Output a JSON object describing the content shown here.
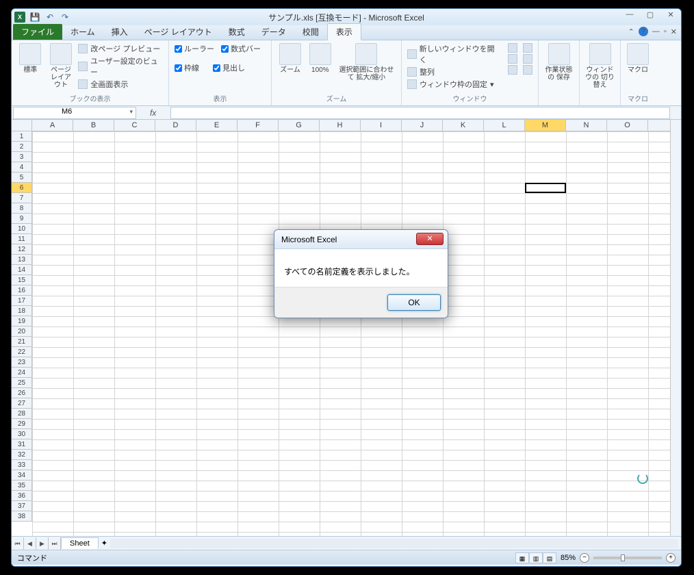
{
  "titlebar": {
    "title": "サンプル.xls [互換モード] - Microsoft Excel",
    "excel_letter": "X"
  },
  "tabs": {
    "file": "ファイル",
    "items": [
      "ホーム",
      "挿入",
      "ページ レイアウト",
      "数式",
      "データ",
      "校閲",
      "表示"
    ],
    "active_index": 6
  },
  "ribbon": {
    "groups": {
      "workbook_views": {
        "label": "ブックの表示",
        "btn_normal": "標準",
        "btn_page_layout": "ページ\nレイアウト",
        "opt_page_break": "改ページ プレビュー",
        "opt_custom_views": "ユーザー設定のビュー",
        "opt_full_screen": "全画面表示"
      },
      "show": {
        "label": "表示",
        "chk_ruler": "ルーラー",
        "chk_formula_bar": "数式バー",
        "chk_gridlines": "枠線",
        "chk_headings": "見出し"
      },
      "zoom": {
        "label": "ズーム",
        "btn_zoom": "ズーム",
        "btn_100": "100%",
        "btn_selection": "選択範囲に合わせて\n拡大/縮小"
      },
      "window": {
        "label": "ウィンドウ",
        "opt_new_window": "新しいウィンドウを開く",
        "opt_arrange": "整列",
        "opt_freeze": "ウィンドウ枠の固定"
      },
      "save_workspace": {
        "btn": "作業状態の\n保存"
      },
      "switch_windows": {
        "btn": "ウィンドウの\n切り替え"
      },
      "macros": {
        "label": "マクロ",
        "btn": "マクロ"
      }
    }
  },
  "namebox": {
    "value": "M6",
    "fx": "fx"
  },
  "columns": [
    "A",
    "B",
    "C",
    "D",
    "E",
    "F",
    "G",
    "H",
    "I",
    "J",
    "K",
    "L",
    "M",
    "N",
    "O"
  ],
  "selected_col_index": 12,
  "rows": [
    1,
    2,
    3,
    4,
    5,
    6,
    7,
    8,
    9,
    10,
    11,
    12,
    13,
    14,
    15,
    16,
    17,
    18,
    19,
    20,
    21,
    22,
    23,
    24,
    25,
    26,
    27,
    28,
    29,
    30,
    31,
    32,
    33,
    34,
    35,
    36,
    37,
    38
  ],
  "selected_row_index": 5,
  "sheet_tabs": {
    "active": "Sheet"
  },
  "statusbar": {
    "mode": "コマンド",
    "zoom": "85%"
  },
  "dialog": {
    "title": "Microsoft Excel",
    "message": "すべての名前定義を表示しました。",
    "ok": "OK"
  }
}
